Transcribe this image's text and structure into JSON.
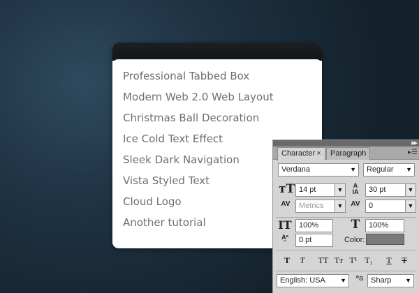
{
  "tutorial_list": {
    "items": [
      "Professional Tabbed Box",
      "Modern Web 2.0 Web Layout",
      "Christmas Ball Decoration",
      "Ice Cold Text Effect",
      "Sleek Dark Navigation",
      "Vista Styled Text",
      "Cloud Logo",
      "Another tutorial"
    ]
  },
  "character_panel": {
    "tabs": {
      "character": "Character",
      "paragraph": "Paragraph",
      "close": "×"
    },
    "font_family": "Verdana",
    "font_style": "Regular",
    "font_size": "14 pt",
    "leading": "30 pt",
    "kerning": "Metrics",
    "tracking": "0",
    "vertical_scale": "100%",
    "horizontal_scale": "100%",
    "baseline_shift": "0 pt",
    "color_label": "Color:",
    "color_value": "#7a7a7a",
    "language": "English: USA",
    "antialias": "Sharp",
    "style_buttons": [
      "T",
      "T",
      "TT",
      "Tт",
      "T¹",
      "T₁",
      "T",
      "T"
    ],
    "icons": {
      "font_size": "font-size-icon",
      "leading": "leading-icon",
      "kerning": "kerning-icon",
      "tracking": "tracking-icon",
      "vertical_scale": "vertical-scale-icon",
      "horizontal_scale": "horizontal-scale-icon",
      "baseline_shift": "baseline-shift-icon",
      "antialias": "antialias-icon"
    }
  }
}
